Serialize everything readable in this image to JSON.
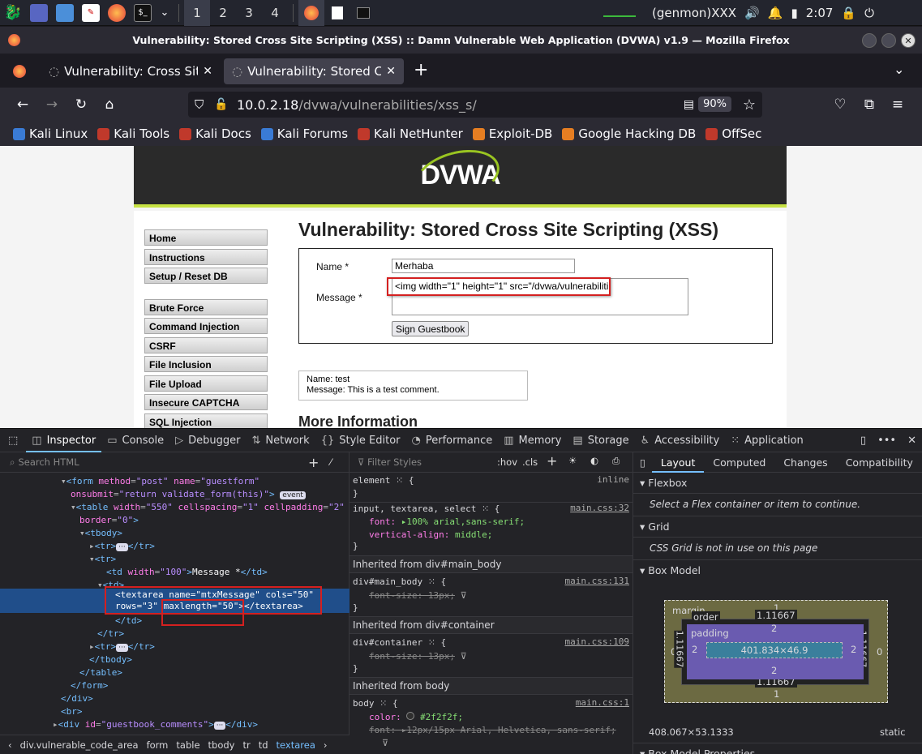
{
  "panel": {
    "workspaces": [
      "1",
      "2",
      "3",
      "4"
    ],
    "genmon": "(genmon)XXX",
    "clock": "2:07"
  },
  "window": {
    "title": "Vulnerability: Stored Cross Site Scripting (XSS) :: Damn Vulnerable Web Application (DVWA) v1.9 — Mozilla Firefox"
  },
  "tabs": [
    {
      "label": "Vulnerability: Cross Site R"
    },
    {
      "label": "Vulnerability: Stored Cros"
    }
  ],
  "nav": {
    "url_host": "10.0.2.18",
    "url_path": "/dvwa/vulnerabilities/xss_s/",
    "zoom": "90%"
  },
  "bookmarks": [
    {
      "label": "Kali Linux",
      "color": "#3a7bd5"
    },
    {
      "label": "Kali Tools",
      "color": "#c0392b"
    },
    {
      "label": "Kali Docs",
      "color": "#c0392b"
    },
    {
      "label": "Kali Forums",
      "color": "#3a7bd5"
    },
    {
      "label": "Kali NetHunter",
      "color": "#c0392b"
    },
    {
      "label": "Exploit-DB",
      "color": "#e67e22"
    },
    {
      "label": "Google Hacking DB",
      "color": "#e67e22"
    },
    {
      "label": "OffSec",
      "color": "#c0392b"
    }
  ],
  "dvwa": {
    "logo": "DVWA",
    "menu": [
      "Home",
      "Instructions",
      "Setup / Reset DB",
      "Brute Force",
      "Command Injection",
      "CSRF",
      "File Inclusion",
      "File Upload",
      "Insecure CAPTCHA",
      "SQL Injection"
    ],
    "title": "Vulnerability: Stored Cross Site Scripting (XSS)",
    "name_label": "Name *",
    "name_value": "Merhaba",
    "message_label": "Message *",
    "message_value": "<img width=\"1\" height=\"1\" src=\"/dvwa/vulnerabiliti",
    "sign_button": "Sign Guestbook",
    "guestbook_name": "Name: test",
    "guestbook_message": "Message: This is a test comment.",
    "more_info": "More Information"
  },
  "devtools": {
    "tools": [
      "Inspector",
      "Console",
      "Debugger",
      "Network",
      "Style Editor",
      "Performance",
      "Memory",
      "Storage",
      "Accessibility",
      "Application"
    ],
    "search_html_placeholder": "Search HTML",
    "filter_styles_placeholder": "Filter Styles",
    "pseudo_toggle": ":hov",
    "class_toggle": ".cls",
    "breadcrumb": [
      "div.vulnerable_code_area",
      "form",
      "table",
      "tbody",
      "tr",
      "td",
      "textarea"
    ],
    "right_tabs": [
      "Layout",
      "Computed",
      "Changes",
      "Compatibility"
    ],
    "flexbox": "Flexbox",
    "flexbox_note": "Select a Flex container or item to continue.",
    "grid": "Grid",
    "grid_note": "CSS Grid is not in use on this page",
    "box_model": "Box Model",
    "box_model_props": "Box Model Properties",
    "bm": {
      "margin_label": "margin",
      "border_label": "order",
      "padding_label": "padding",
      "margin_top": "1",
      "margin_bottom": "1",
      "margin_left": "0",
      "margin_right": "0",
      "border_top": "1.11667",
      "border_bottom": "1.11667",
      "border_left": "1.11667",
      "border_right": "1.11667",
      "padding_top": "2",
      "padding_bottom": "2",
      "padding_left": "2",
      "padding_right": "2",
      "content": "401.834×46.9",
      "size": "408.067×53.1333",
      "position": "static"
    },
    "rules": {
      "element_selector": "element",
      "element_source": "inline",
      "input_selector": "input, textarea, select",
      "input_source": "main.css:32",
      "font_prop": "font:",
      "font_val": "100% arial,sans-serif;",
      "va_prop": "vertical-align:",
      "va_val": "middle;",
      "inherit_main": "Inherited from div#main_body",
      "main_selector": "div#main_body",
      "main_source": "main.css:131",
      "main_fs": "font-size: 13px;",
      "inherit_container": "Inherited from div#container",
      "container_selector": "div#container",
      "container_source": "main.css:109",
      "container_fs": "font-size: 13px;",
      "inherit_body": "Inherited from body",
      "body_selector": "body",
      "body_source": "main.css:1",
      "color_prop": "color:",
      "color_val": "#2f2f2f;",
      "body_font": "font: ▸12px/15px Arial, Helvetica, sans-serif;"
    }
  }
}
